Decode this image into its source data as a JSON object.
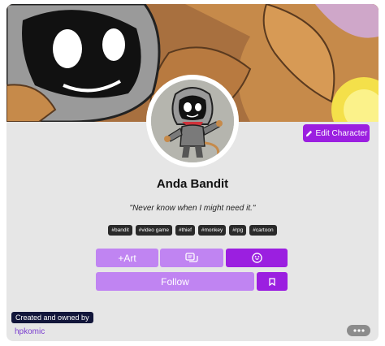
{
  "profile": {
    "name": "Anda Bandit",
    "quote": "\"Never know when I might need it.\"",
    "tags": [
      "#bandit",
      "#video game",
      "#thief",
      "#monkey",
      "#rpg",
      "#cartoon"
    ]
  },
  "actions": {
    "edit_label": "Edit Character",
    "art_label": "+Art",
    "follow_label": "Follow"
  },
  "footer": {
    "owned_label": "Created and owned by",
    "owner": "hpkomic"
  },
  "icons": {
    "edit": "pencil-icon",
    "chat": "chat-icon",
    "emoji": "smiley-icon",
    "bookmark": "bookmark-icon",
    "more": "ellipsis-icon"
  },
  "colors": {
    "accent": "#9b1fe0",
    "accent_light": "#c084f2",
    "tag_bg": "#2a2a2a",
    "owned_bg": "#12163a",
    "link": "#7b3fcf"
  }
}
